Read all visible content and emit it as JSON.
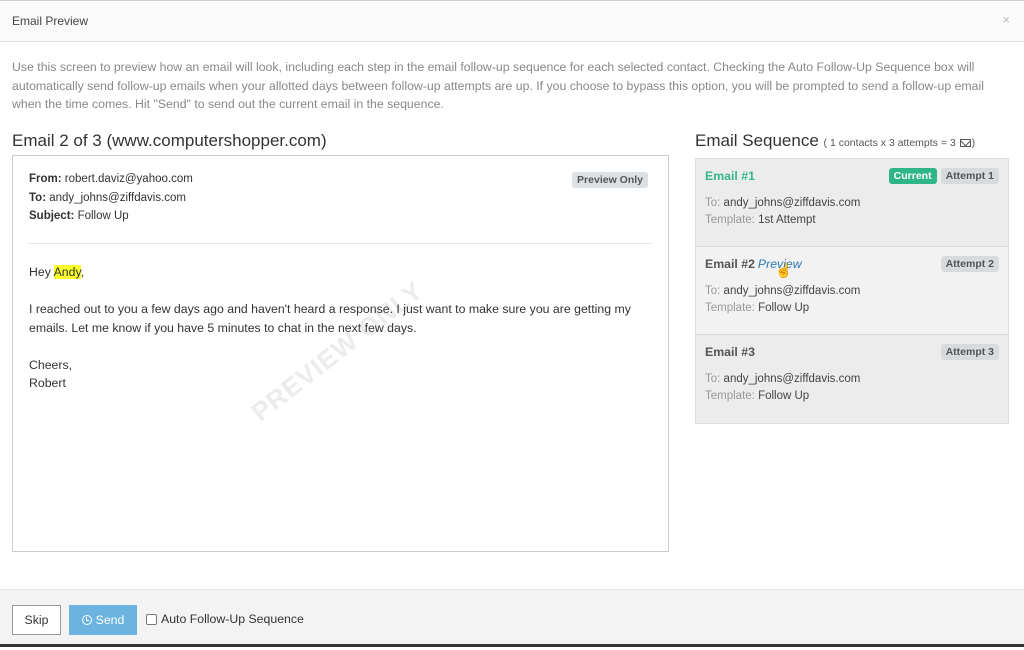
{
  "header": {
    "title": "Email Preview",
    "close_label": "×"
  },
  "intro": "Use this screen to preview how an email will look, including each step in the email follow-up sequence for each selected contact. Checking the Auto Follow-Up Sequence box will automatically send follow-up emails when your allotted days between follow-up attempts are up. If you choose to bypass this option, you will be prompted to send a follow-up email when the time comes. Hit \"Send\" to send out the current email in the sequence.",
  "preview": {
    "title": "Email 2 of 3 (www.computershopper.com)",
    "badge": "Preview Only",
    "from_label": "From:",
    "from": "robert.daviz@yahoo.com",
    "to_label": "To:",
    "to": "andy_johns@ziffdavis.com",
    "subject_label": "Subject:",
    "subject": "Follow Up",
    "greeting_prefix": "Hey ",
    "greeting_name": "Andy",
    "greeting_suffix": ",",
    "paragraph": "I reached out to you a few days ago and haven't heard a response. I just want to make sure you are getting my emails. Let me know if you have 5 minutes to chat in the next few days.",
    "signoff": "Cheers,",
    "signature": "Robert",
    "watermark": "PREVIEW ONLY"
  },
  "sequence": {
    "title": "Email Sequence",
    "summary_prefix": "( 1 contacts x 3 attempts = 3",
    "summary_suffix": ")",
    "to_label": "To:",
    "template_label": "Template:",
    "items": [
      {
        "name": "Email #1",
        "current_badge": "Current",
        "attempt": "Attempt 1",
        "to": "andy_johns@ziffdavis.com",
        "template": "1st Attempt"
      },
      {
        "name": "Email #2",
        "preview_link": "Preview",
        "attempt": "Attempt 2",
        "to": "andy_johns@ziffdavis.com",
        "template": "Follow Up"
      },
      {
        "name": "Email #3",
        "attempt": "Attempt 3",
        "to": "andy_johns@ziffdavis.com",
        "template": "Follow Up"
      }
    ]
  },
  "footer": {
    "skip_label": "Skip",
    "send_label": "Send",
    "auto_label": "Auto Follow-Up Sequence",
    "auto_checked": false
  },
  "colors": {
    "accent_green": "#2fb688",
    "send_blue": "#6bb4e0",
    "link_blue": "#2b78b4",
    "highlight": "#fcff2a"
  }
}
